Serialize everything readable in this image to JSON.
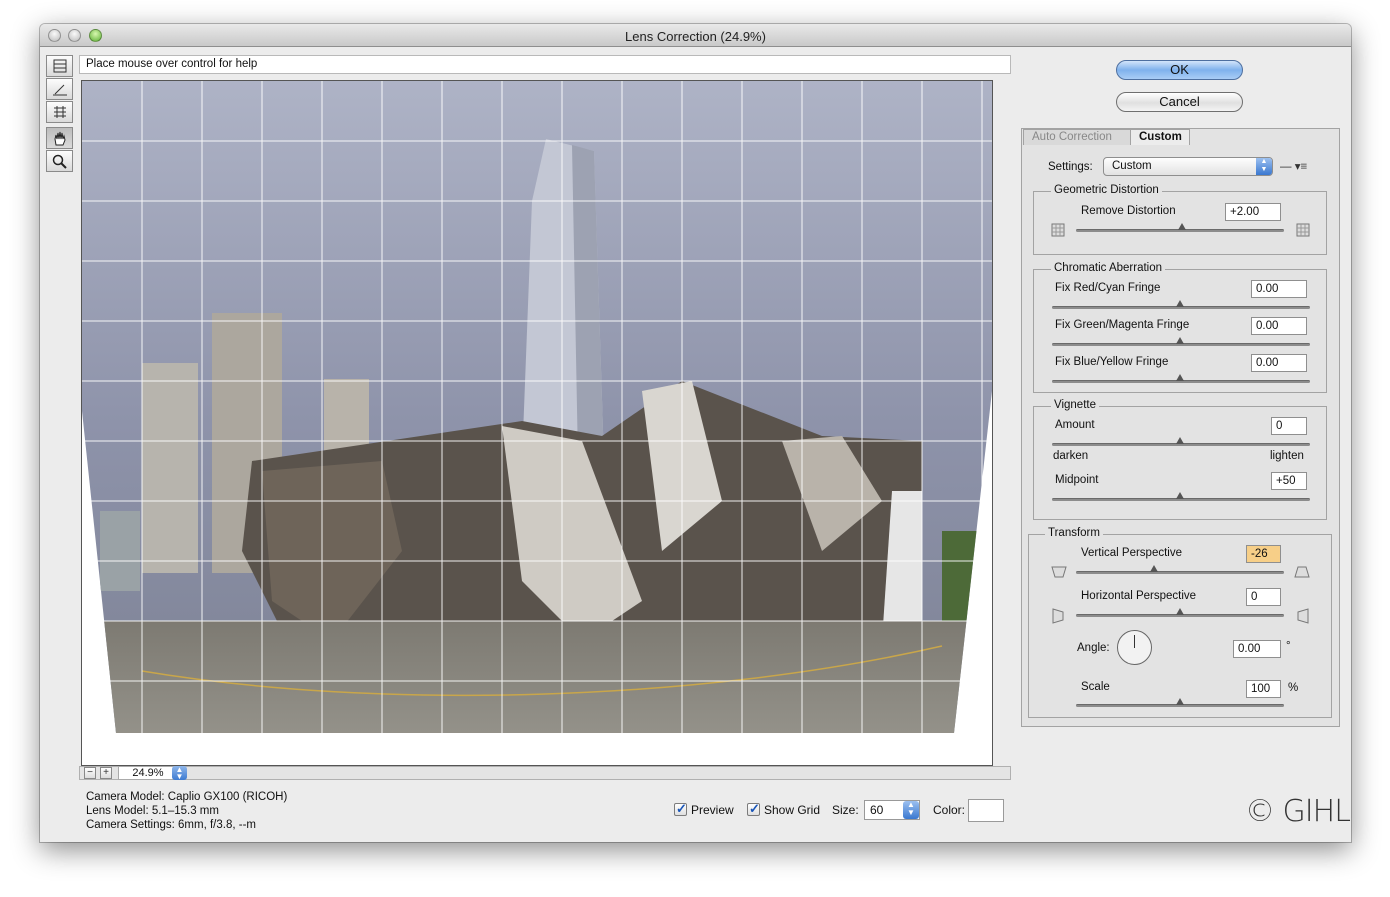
{
  "window": {
    "title": "Lens Correction (24.9%)"
  },
  "helpbar": {
    "text": "Place mouse over control for help"
  },
  "tools": [
    "remove-distortion-tool",
    "straighten-tool",
    "move-grid-tool",
    "hand-tool",
    "zoom-tool"
  ],
  "zoom": {
    "value": "24.9%",
    "minus": "−",
    "plus": "+"
  },
  "camera": {
    "model": "Camera Model: Caplio GX100 (RICOH)",
    "lens": "Lens Model: 5.1–15.3 mm",
    "settings": "Camera Settings: 6mm, f/3.8, --m"
  },
  "bottom": {
    "preview_label": "Preview",
    "show_grid_label": "Show Grid",
    "size_label": "Size:",
    "size_value": "60",
    "color_label": "Color:",
    "logo": "© GIHL"
  },
  "buttons": {
    "ok": "OK",
    "cancel": "Cancel"
  },
  "tabs": {
    "auto": "Auto Correction",
    "custom": "Custom"
  },
  "settings": {
    "label": "Settings:",
    "value": "Custom"
  },
  "geometric": {
    "title": "Geometric Distortion",
    "remove_label": "Remove Distortion",
    "remove_value": "+2.00",
    "remove_level": 0.52
  },
  "chromatic": {
    "title": "Chromatic Aberration",
    "red_label": "Fix Red/Cyan Fringe",
    "red_value": "0.00",
    "green_label": "Fix Green/Magenta Fringe",
    "green_value": "0.00",
    "blue_label": "Fix Blue/Yellow Fringe",
    "blue_value": "0.00"
  },
  "vignette": {
    "title": "Vignette",
    "amount_label": "Amount",
    "amount_value": "0",
    "darken": "darken",
    "lighten": "lighten",
    "midpoint_label": "Midpoint",
    "midpoint_value": "+50"
  },
  "transform": {
    "title": "Transform",
    "vertical_label": "Vertical Perspective",
    "vertical_value": "-26",
    "horizontal_label": "Horizontal Perspective",
    "horizontal_value": "0",
    "angle_label": "Angle:",
    "angle_value": "0.00",
    "angle_unit": "°",
    "scale_label": "Scale",
    "scale_value": "100",
    "scale_unit": "%"
  },
  "colors": {
    "accent": "#3d7bd2",
    "highlight": "#f7cf88"
  }
}
